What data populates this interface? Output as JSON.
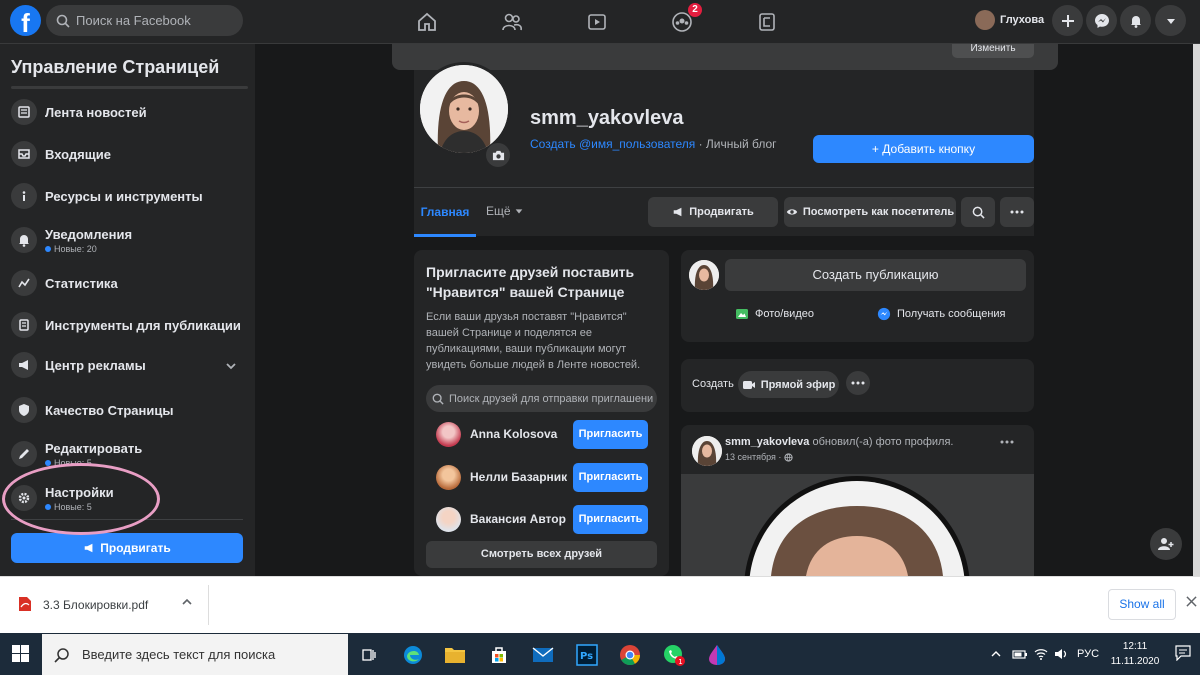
{
  "topbar": {
    "search_placeholder": "Поиск на Facebook",
    "notifications_count": "2",
    "user_name": "Глухова"
  },
  "sidebar": {
    "title": "Управление Страницей",
    "items": [
      {
        "label": "Лента новостей",
        "icon": "news-feed-icon"
      },
      {
        "label": "Входящие",
        "icon": "inbox-icon"
      },
      {
        "label": "Ресурсы и инструменты",
        "icon": "info-icon"
      },
      {
        "label": "Уведомления",
        "sub": "Новые: 20",
        "icon": "bell-icon"
      },
      {
        "label": "Статистика",
        "icon": "chart-icon"
      },
      {
        "label": "Инструменты для публикации",
        "icon": "tools-icon"
      },
      {
        "label": "Центр рекламы",
        "icon": "megaphone-icon"
      },
      {
        "label": "Качество Страницы",
        "icon": "shield-icon"
      },
      {
        "label": "Редактировать",
        "sub": "Новые: 5",
        "icon": "pencil-icon"
      },
      {
        "label": "Настройки",
        "sub": "Новые: 5",
        "icon": "gear-icon"
      }
    ],
    "promote_label": "Продвигать"
  },
  "page": {
    "cover_button": "Изменить",
    "name": "smm_yakovleva",
    "username_link": "Создать @имя_пользователя",
    "category": " · Личный блог",
    "add_button": "+ Добавить кнопку",
    "tabs": {
      "main": "Главная",
      "more": "Ещё"
    },
    "actions": {
      "promote": "Продвигать",
      "view_as": "Посмотреть как посетитель"
    }
  },
  "invite": {
    "title": "Пригласите друзей поставить \"Нравится\" вашей Странице",
    "description": "Если ваши друзья поставят \"Нравится\" вашей Странице и поделятся ее публикациями, ваши публикации могут увидеть больше людей в Ленте новостей.",
    "search_placeholder": "Поиск друзей для отправки приглашени",
    "friends": [
      {
        "name": "Anna Kolosova",
        "button": "Пригласить"
      },
      {
        "name": "Нелли Базарник",
        "button": "Пригласить"
      },
      {
        "name": "Вакансия Автор",
        "button": "Пригласить"
      }
    ],
    "see_all": "Смотреть всех друзей"
  },
  "composer": {
    "create_post": "Создать публикацию",
    "photo_video": "Фото/видео",
    "get_messages": "Получать сообщения"
  },
  "create_bar": {
    "label": "Создать",
    "live": "Прямой эфир"
  },
  "post": {
    "author": "smm_yakovleva",
    "action": " обновил(-а) фото профиля.",
    "date": "13 сентября ·"
  },
  "download_bar": {
    "file_name": "3.3 Блокировки.pdf",
    "show_all": "Show all"
  },
  "taskbar": {
    "search_placeholder": "Введите здесь текст для поиска",
    "language": "РУС",
    "time": "12:11",
    "date": "11.11.2020"
  },
  "colors": {
    "accent": "#2d88ff",
    "background": "#18191a",
    "surface": "#242526",
    "highlight_circle": "#e89ec4"
  }
}
